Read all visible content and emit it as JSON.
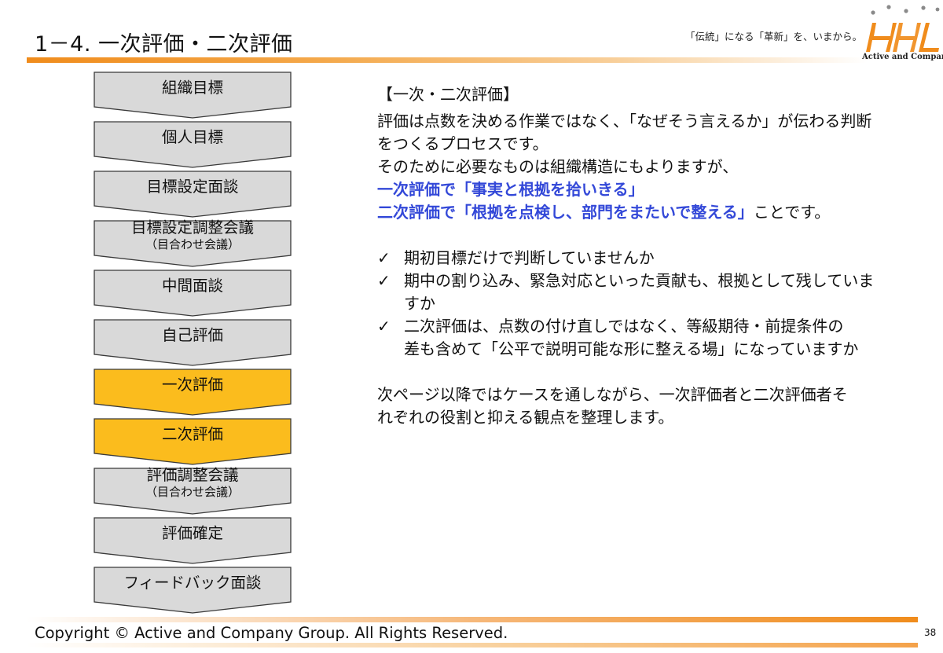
{
  "header": {
    "title": "1－4.  一次評価・二次評価",
    "tagline": "「伝統」になる「革新」を、いまから。",
    "logo_text": "Active and Company"
  },
  "flow": {
    "steps": [
      {
        "label": "組織目標",
        "sub": "",
        "highlight": false
      },
      {
        "label": "個人目標",
        "sub": "",
        "highlight": false
      },
      {
        "label": "目標設定面談",
        "sub": "",
        "highlight": false
      },
      {
        "label": "目標設定調整会議",
        "sub": "（目合わせ会議）",
        "highlight": false
      },
      {
        "label": "中間面談",
        "sub": "",
        "highlight": false
      },
      {
        "label": "自己評価",
        "sub": "",
        "highlight": false
      },
      {
        "label": "一次評価",
        "sub": "",
        "highlight": true
      },
      {
        "label": "二次評価",
        "sub": "",
        "highlight": true
      },
      {
        "label": "評価調整会議",
        "sub": "（目合わせ会議）",
        "highlight": false
      },
      {
        "label": "評価確定",
        "sub": "",
        "highlight": false
      },
      {
        "label": "フィードバック面談",
        "sub": "",
        "highlight": false
      }
    ],
    "colors": {
      "normal": "#d9d9d9",
      "highlight": "#fbbc1d",
      "stroke": "#3a3a3a"
    }
  },
  "content": {
    "heading": "【一次・二次評価】",
    "intro_line1": "評価は点数を決める作業ではなく、「なぜそう言えるか」が伝わる判断",
    "intro_line2": "をつくるプロセスです。",
    "intro_line3": "そのために必要なものは組織構造にもよりますが、",
    "blue_line1": "一次評価で「事実と根拠を拾いきる」",
    "blue_line2": "二次評価で「根拠を点検し、部門をまたいで整える」",
    "line5_tail": "ことです。",
    "check_mark": "✓",
    "check1": "期初目標だけで判断していませんか",
    "check2_line1": "期中の割り込み、緊急対応といった貢献も、根拠として残していま",
    "check2_line2": "すか",
    "check3_line1": "二次評価は、点数の付け直しではなく、等級期待・前提条件の",
    "check3_line2": "差も含めて「公平で説明可能な形に整える場」になっていますか",
    "closing_line1": "次ページ以降ではケースを通しながら、一次評価者と二次評価者そ",
    "closing_line2": "れぞれの役割と抑える観点を整理します。",
    "accent_color": "#3348d8"
  },
  "footer": {
    "copyright": "Copyright © Active and Company Group. All Rights Reserved.",
    "page_number": "38"
  }
}
